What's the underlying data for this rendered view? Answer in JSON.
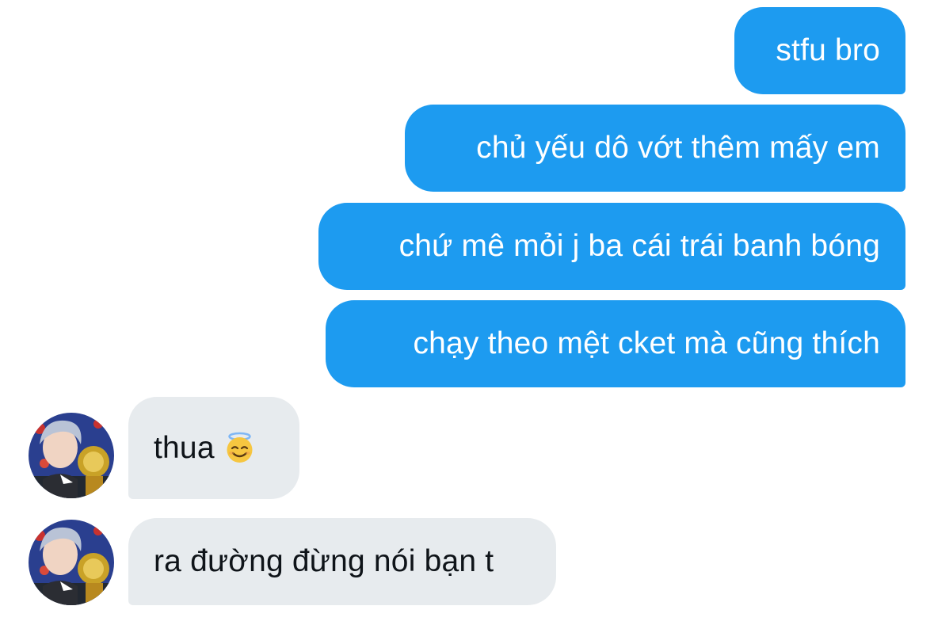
{
  "conversation": {
    "sent_messages": [
      {
        "text": "stfu bro"
      },
      {
        "text": "chủ yếu dô vớt thêm mấy em"
      },
      {
        "text": "chứ mê mỏi j ba cái trái banh bóng"
      },
      {
        "text": "chạy theo mệt cket mà cũng thích"
      }
    ],
    "received_messages": [
      {
        "text": "thua",
        "emoji": "smiling-face-with-halo-emoji"
      },
      {
        "text": "ra đường đừng nói bạn t"
      }
    ],
    "avatar_icon": "user-avatar-photo"
  },
  "colors": {
    "sent_bubble": "#1d9bf0",
    "sent_text": "#ffffff",
    "received_bubble": "#e7ebee",
    "received_text": "#0f1419",
    "background": "#ffffff"
  }
}
